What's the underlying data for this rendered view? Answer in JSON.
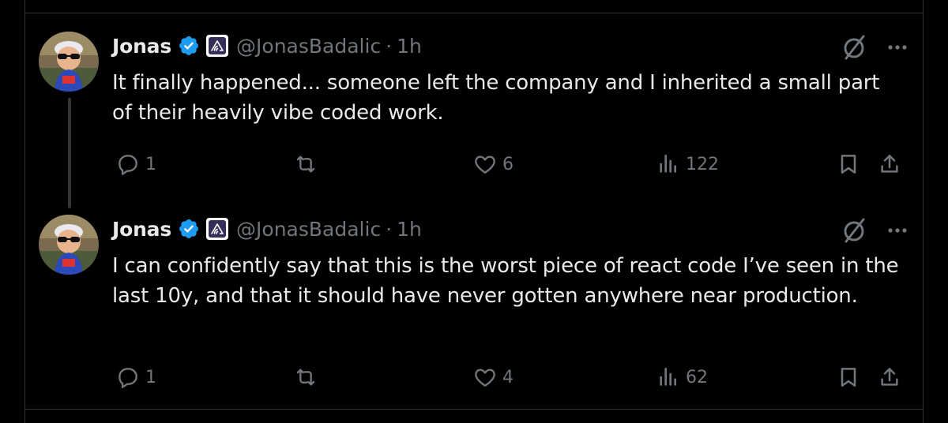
{
  "tweets": [
    {
      "author": {
        "name": "Jonas",
        "handle": "@JonasBadalic",
        "time": "1h"
      },
      "text": "It finally happened... someone left the company and I inherited a small part of their heavily vibe coded work.",
      "stats": {
        "replies": "1",
        "likes": "6",
        "views": "122"
      }
    },
    {
      "author": {
        "name": "Jonas",
        "handle": "@JonasBadalic",
        "time": "1h"
      },
      "text": "I can confidently say that this is the worst piece of react code I’ve seen in the last 10y, and that it should have never gotten anywhere near production.",
      "stats": {
        "replies": "1",
        "likes": "4",
        "views": "62"
      }
    }
  ],
  "separator": "·",
  "icons": {
    "verified": "verified-badge-icon",
    "org": "sentry-logo-icon",
    "grok": "grok-icon",
    "more": "more-icon",
    "reply": "reply-icon",
    "repost": "repost-icon",
    "like": "heart-icon",
    "views": "views-icon",
    "bookmark": "bookmark-icon",
    "share": "share-icon"
  },
  "colors": {
    "background": "#000000",
    "text": "#e7e9ea",
    "muted": "#71767b",
    "verified": "#1d9bf0",
    "border": "#2f3336"
  }
}
